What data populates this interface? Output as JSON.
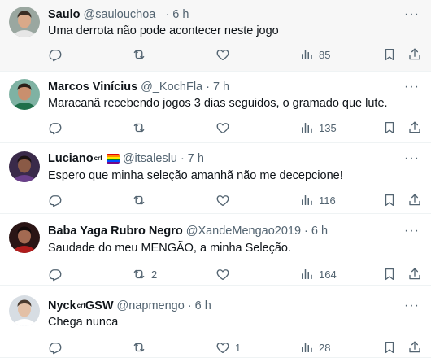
{
  "tweets": [
    {
      "name": "Saulo",
      "name_badge": "",
      "has_flag": false,
      "handle": "@saulouchoa_",
      "time": "6 h",
      "text": "Uma derrota não pode acontecer neste jogo",
      "replies": "",
      "retweets": "",
      "likes": "",
      "views": "85",
      "avatar": {
        "bg": "#9aa7a0",
        "skin": "#d9a989",
        "hair": "#3a2c22",
        "shirt": "#e6e6e6"
      }
    },
    {
      "name": "Marcos Vinícius",
      "name_badge": "",
      "has_flag": false,
      "handle": "@_KochFla",
      "time": "7 h",
      "text": "Maracanã recebendo jogos 3 dias seguidos, o gramado que lute.",
      "replies": "",
      "retweets": "",
      "likes": "",
      "views": "135",
      "avatar": {
        "bg": "#7fb2a3",
        "skin": "#c98f6e",
        "hair": "#2b1f18",
        "shirt": "#1f6f4a"
      }
    },
    {
      "name": "Luciano",
      "name_badge": "crf",
      "has_flag": true,
      "handle": "@itsaleslu",
      "time": "7 h",
      "text": "Espero que minha seleção amanhã não me decepcione!",
      "replies": "",
      "retweets": "",
      "likes": "",
      "views": "116",
      "avatar": {
        "bg": "#3a2a4a",
        "skin": "#8a5a46",
        "hair": "#1b1212",
        "shirt": "#6a3f8a"
      }
    },
    {
      "name": "Baba Yaga Rubro Negro",
      "name_badge": "",
      "has_flag": false,
      "handle": "@XandeMengao2019",
      "time": "6 h",
      "text": "Saudade do meu MENGÃO, a minha Seleção.",
      "replies": "",
      "retweets": "2",
      "likes": "",
      "views": "164",
      "avatar": {
        "bg": "#2a1515",
        "skin": "#a36a52",
        "hair": "#120a0a",
        "shirt": "#b01c1c"
      }
    },
    {
      "name": "Nyck",
      "name_badge": "crf",
      "name_suffix": "GSW",
      "has_flag": false,
      "handle": "@napmengo",
      "time": "6 h",
      "text": "Chega nunca",
      "replies": "",
      "retweets": "",
      "likes": "1",
      "views": "28",
      "avatar": {
        "bg": "#d7dde3",
        "skin": "#e3c0a6",
        "hair": "#4a3a2e",
        "shirt": "#ffffff"
      }
    }
  ],
  "icons": {
    "reply": "reply-icon",
    "retweet": "retweet-icon",
    "like": "heart-icon",
    "views": "views-icon",
    "bookmark": "bookmark-icon",
    "share": "share-icon",
    "more": "more-icon"
  },
  "colors": {
    "text": "#0f1419",
    "muted": "#536471",
    "highlight_bg": "#f7f7f7",
    "divider": "#eff3f4"
  }
}
